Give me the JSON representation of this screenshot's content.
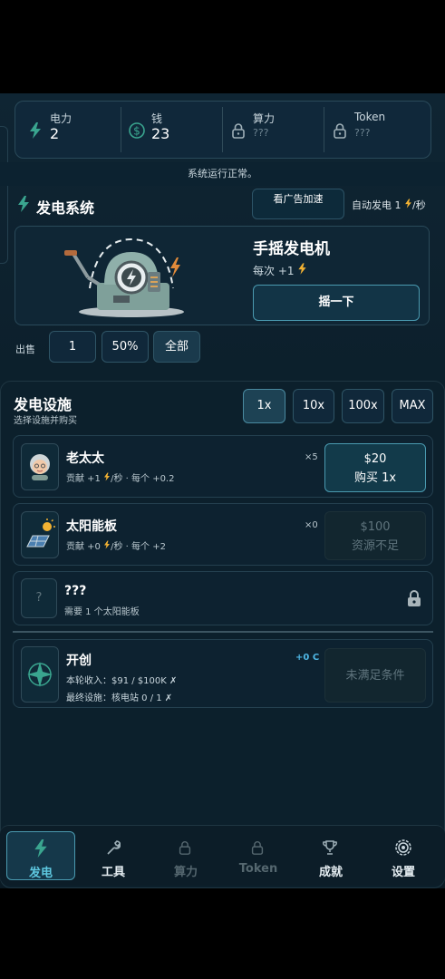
{
  "resources": [
    {
      "label": "电力",
      "value": "2",
      "icon": "bolt-icon"
    },
    {
      "label": "钱",
      "value": "23",
      "icon": "dollar-icon"
    },
    {
      "label": "算力",
      "value": "???",
      "icon": "lock-icon"
    },
    {
      "label": "Token",
      "value": "???",
      "icon": "lock-icon"
    }
  ],
  "status_text": "系统运行正常。",
  "power_system": {
    "title": "发电系统",
    "ad_button": "看广告加速",
    "auto_label": "自动发电",
    "auto_value": "1",
    "auto_unit": "/秒",
    "generator_name": "手摇发电机",
    "per_click_label": "每次 +1",
    "crank_button": "摇一下"
  },
  "sell": {
    "label": "出售",
    "options": [
      "1",
      "50%",
      "全部"
    ]
  },
  "facilities": {
    "title": "发电设施",
    "subtitle": "选择设施并购买",
    "multipliers": [
      "1x",
      "10x",
      "100x",
      "MAX"
    ],
    "items": [
      {
        "name": "老太太",
        "desc_prefix": "贡献 +1",
        "desc_suffix": "/秒 · 每个 +0.2",
        "count": "×5",
        "price": "$20",
        "action": "购买 1x"
      },
      {
        "name": "太阳能板",
        "desc_prefix": "贡献 +0",
        "desc_suffix": "/秒 · 每个 +2",
        "count": "×0",
        "price": "$100",
        "action": "资源不足"
      }
    ],
    "locked": {
      "name": "???",
      "desc": "需要 1 个太阳能板",
      "icon_text": "?"
    },
    "special": {
      "name": "开创",
      "badge": "+0 C",
      "line1": "本轮收入：$91 / $100K ✗",
      "line2": "最终设施：核电站 0 / 1 ✗",
      "action": "未满足条件"
    }
  },
  "nav": [
    {
      "label": "发电",
      "icon": "bolt-icon",
      "active": true
    },
    {
      "label": "工具",
      "icon": "wrench-icon",
      "active": false
    },
    {
      "label": "算力",
      "icon": "lock-icon",
      "active": false
    },
    {
      "label": "Token",
      "icon": "lock-icon",
      "active": false
    },
    {
      "label": "成就",
      "icon": "trophy-icon",
      "active": false
    },
    {
      "label": "设置",
      "icon": "gear-icon",
      "active": false
    }
  ],
  "colors": {
    "accent": "#5ec8e0",
    "bolt": "#f2b233",
    "background": "#0f2533"
  }
}
